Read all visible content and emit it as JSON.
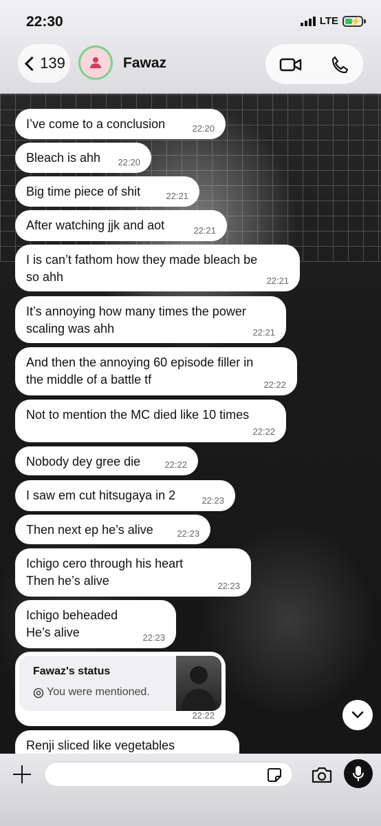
{
  "status_bar": {
    "time": "22:30",
    "network": "LTE"
  },
  "header": {
    "back_count": "139",
    "contact_name": "Fawaz"
  },
  "messages": [
    {
      "text": "I’ve come to a conclusion",
      "time": "22:20"
    },
    {
      "text": "Bleach is ahh",
      "time": "22:20"
    },
    {
      "text": "Big time piece of shit",
      "time": "22:21"
    },
    {
      "text": "After watching jjk and aot",
      "time": "22:21"
    },
    {
      "text": "I is can’t fathom how they made bleach be\nso ahh",
      "time": "22:21"
    },
    {
      "text": "It’s annoying how many times the power\nscaling was ahh",
      "time": "22:21"
    },
    {
      "text": "And then the annoying 60 episode filler in\nthe middle of a battle tf",
      "time": "22:22"
    },
    {
      "text": "Not to mention the MC died like 10 times",
      "time": "22:22"
    },
    {
      "text": "Nobody dey gree die",
      "time": "22:22"
    },
    {
      "text": "I saw em cut hitsugaya in 2",
      "time": "22:23"
    },
    {
      "text": "Then next ep he’s alive",
      "time": "22:23"
    },
    {
      "text": "Ichigo cero through his heart\nThen he’s alive",
      "time": "22:23"
    },
    {
      "text": "Ichigo beheaded\nHe’s alive",
      "time": "22:23"
    },
    {
      "text": "Renji sliced like vegetables",
      "time": ""
    }
  ],
  "status_reply": {
    "title": "Fawaz's status",
    "subtitle": "You were mentioned.",
    "time": "22:22"
  },
  "icons": {
    "back": "chevron-left-icon",
    "avatar": "person-icon",
    "video": "video-camera-icon",
    "call": "phone-icon",
    "attach": "plus-icon",
    "sticker": "sticker-icon",
    "camera": "camera-icon",
    "mic": "microphone-icon",
    "scroll": "chevron-down-icon",
    "mention": "at-sign-icon"
  },
  "colors": {
    "avatar_ring": "#7cd28a",
    "avatar_bg": "#f9d6dc",
    "battery_fill": "#33c759"
  }
}
